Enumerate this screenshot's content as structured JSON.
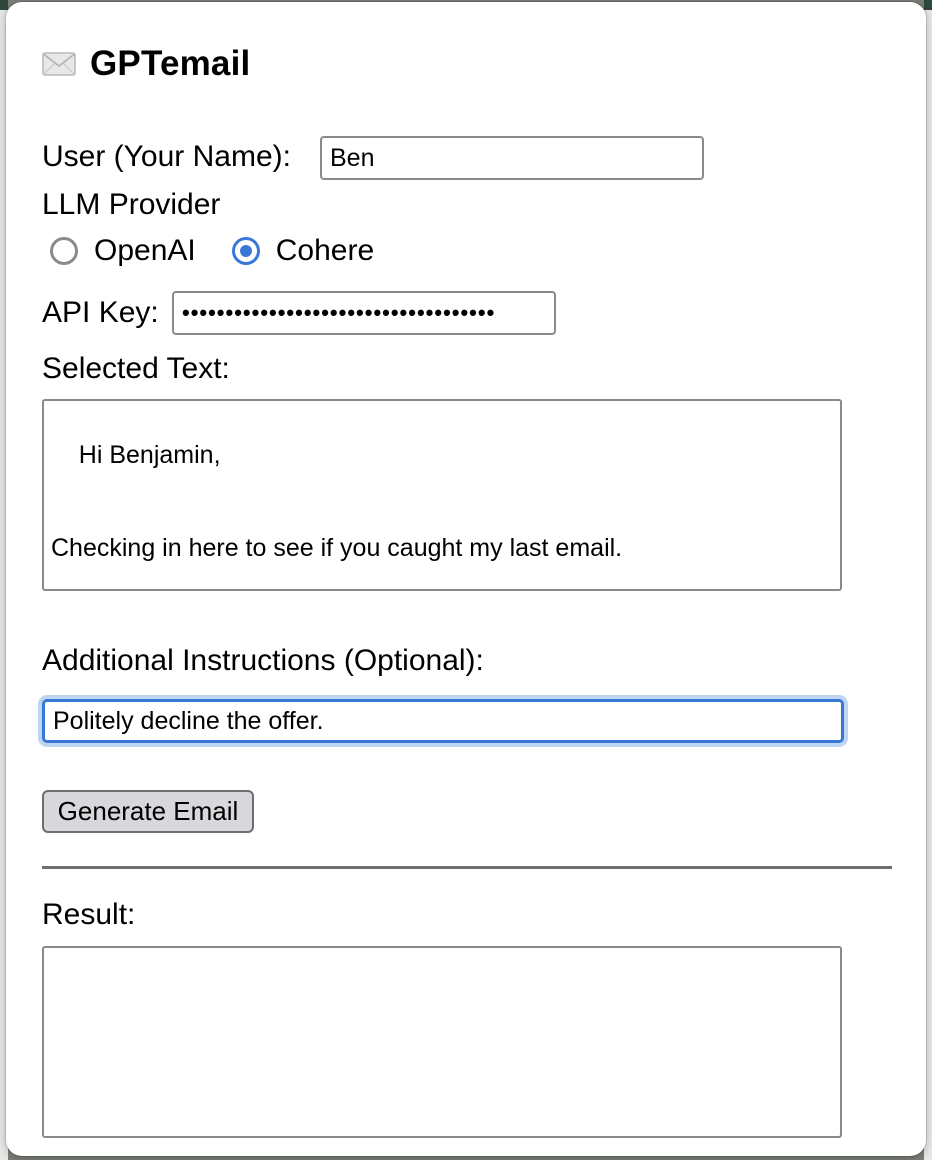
{
  "app": {
    "title": "GPTemail",
    "title_icon": "envelope-icon"
  },
  "form": {
    "user_label": "User (Your Name):",
    "user_value": "Ben",
    "provider_label": "LLM Provider",
    "providers": [
      {
        "label": "OpenAI",
        "selected": false
      },
      {
        "label": "Cohere",
        "selected": true
      }
    ],
    "api_key_label": "API Key:",
    "api_key_value": "••••••••••••••••••••••••••••••••••••",
    "selected_text_label": "Selected Text:",
    "selected_text_value": "Hi Benjamin,\n\n\nChecking in here to see if you caught my last email.",
    "instructions_label": "Additional Instructions (Optional):",
    "instructions_value": "Politely decline the offer.",
    "generate_button": "Generate Email",
    "result_label": "Result:",
    "result_value": ""
  },
  "colors": {
    "accent": "#3a78d8",
    "focus_ring": "#bfd6f3",
    "button_bg": "#d8d8dc"
  }
}
